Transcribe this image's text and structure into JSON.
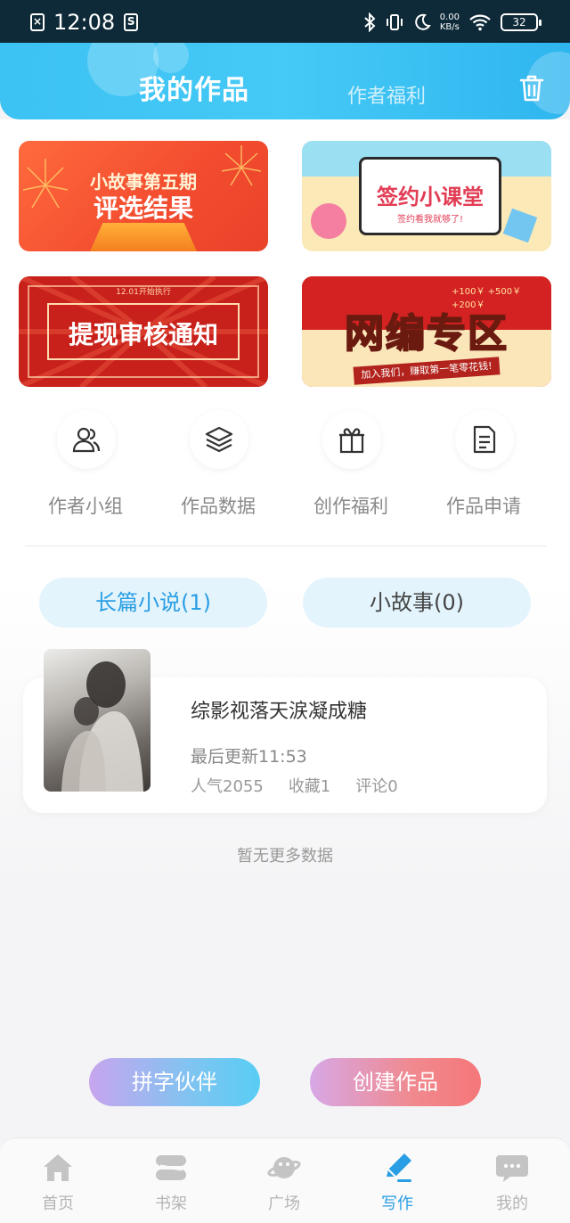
{
  "status_bar": {
    "time": "12:08",
    "speed_value": "0.00",
    "speed_unit": "KB/s",
    "battery": "32"
  },
  "header": {
    "tabs": [
      {
        "label": "我的作品",
        "active": true
      },
      {
        "label": "作者福利",
        "active": false
      }
    ],
    "trash_icon": "trash-icon"
  },
  "banners": [
    {
      "line1": "小故事第五期",
      "line2": "评选结果",
      "color": "#f24b2f"
    },
    {
      "title": "签约小课堂",
      "subtitle": "签约看我就够了!",
      "color": "#fbe9b8"
    },
    {
      "small": "12.01开始执行",
      "title": "提现审核通知",
      "color": "#c8201a"
    },
    {
      "title": "网编专区",
      "ribbon": "加入我们，赚取第一笔零花钱!",
      "prices": "+100￥ +500￥ +200￥",
      "color": "#d42222"
    }
  ],
  "quick_links": [
    {
      "label": "作者小组",
      "icon": "users-icon"
    },
    {
      "label": "作品数据",
      "icon": "layers-icon"
    },
    {
      "label": "创作福利",
      "icon": "gift-icon"
    },
    {
      "label": "作品申请",
      "icon": "document-icon"
    }
  ],
  "categories": [
    {
      "label": "长篇小说(1)",
      "active": true
    },
    {
      "label": "小故事(0)",
      "active": false
    }
  ],
  "works": [
    {
      "title": "综影视落天涙凝成糖",
      "last_update": "最后更新11:53",
      "popularity": "人气2055",
      "favorites": "收藏1",
      "comments": "评论0"
    }
  ],
  "no_more": "暂无更多数据",
  "actions": {
    "partner": "拼字伙伴",
    "create": "创建作品"
  },
  "bottom_nav": [
    {
      "label": "首页",
      "icon": "home-icon",
      "active": false
    },
    {
      "label": "书架",
      "icon": "bookshelf-icon",
      "active": false
    },
    {
      "label": "广场",
      "icon": "planet-icon",
      "active": false
    },
    {
      "label": "写作",
      "icon": "pen-icon",
      "active": true
    },
    {
      "label": "我的",
      "icon": "chat-bubble-icon",
      "active": false
    }
  ],
  "colors": {
    "accent": "#2a9ee4",
    "header": "#3cc2f3",
    "nav_inactive": "#b5b5b5"
  }
}
